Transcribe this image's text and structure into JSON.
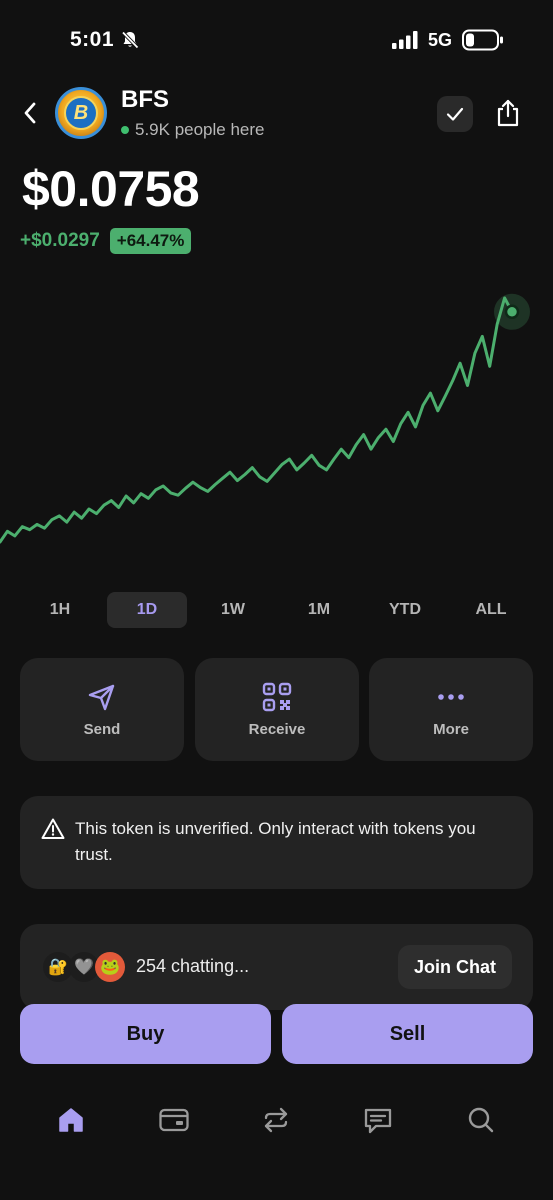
{
  "status_bar": {
    "time": "5:01",
    "network": "5G",
    "icons": [
      "bell-slash-icon",
      "signal-icon",
      "battery-icon"
    ]
  },
  "header": {
    "back_icon": "chevron-left-icon",
    "token_name": "BFS",
    "presence": "5.9K people here",
    "presence_color": "#3fbf6f",
    "avatar_letter": "B",
    "actions": [
      "check-icon",
      "share-icon"
    ]
  },
  "price": {
    "value": "$0.0758",
    "change_abs": "+$0.0297",
    "change_pct": "+64.47%",
    "positive_color": "#4caf6e"
  },
  "chart_data": {
    "type": "line",
    "series": [
      {
        "values": [
          0.0458,
          0.0472,
          0.0466,
          0.0478,
          0.0474,
          0.0481,
          0.0476,
          0.0487,
          0.0492,
          0.0484,
          0.0497,
          0.0489,
          0.0501,
          0.0495,
          0.0506,
          0.0512,
          0.0503,
          0.0518,
          0.0509,
          0.0521,
          0.0515,
          0.0526,
          0.0531,
          0.0522,
          0.0519,
          0.0528,
          0.0536,
          0.0529,
          0.0524,
          0.0533,
          0.0541,
          0.0549,
          0.0538,
          0.0546,
          0.0555,
          0.0543,
          0.0537,
          0.0548,
          0.0559,
          0.0566,
          0.0552,
          0.0561,
          0.0571,
          0.0558,
          0.0552,
          0.0566,
          0.0579,
          0.0568,
          0.0585,
          0.0598,
          0.0579,
          0.0594,
          0.0605,
          0.0589,
          0.0612,
          0.0627,
          0.0608,
          0.0636,
          0.0652,
          0.0629,
          0.0648,
          0.0668,
          0.0691,
          0.0662,
          0.0704,
          0.0726,
          0.0687,
          0.0742,
          0.0776,
          0.0758
        ],
        "color": "#4caf6e"
      }
    ],
    "xlabel": "",
    "ylabel": "",
    "grid": false,
    "current_point": 0.0758
  },
  "ranges": [
    "1H",
    "1D",
    "1W",
    "1M",
    "YTD",
    "ALL"
  ],
  "active_range": "1D",
  "active_range_color": "#a79af0",
  "actions": [
    {
      "label": "Send",
      "icon": "send-icon"
    },
    {
      "label": "Receive",
      "icon": "qr-code-icon"
    },
    {
      "label": "More",
      "icon": "more-dots-icon"
    }
  ],
  "accent_color": "#a99ef0",
  "warning": {
    "icon": "warning-triangle-icon",
    "text": "This token is unverified. Only interact with tokens you trust."
  },
  "chat": {
    "count_label": "254 chatting...",
    "join_label": "Join Chat",
    "avatars": [
      "🔐",
      "🩶",
      "🐸"
    ]
  },
  "trade": {
    "buy_label": "Buy",
    "sell_label": "Sell"
  },
  "nav": {
    "items": [
      "home-icon",
      "wallet-card-icon",
      "swap-icon",
      "chat-icon",
      "search-icon"
    ],
    "active": "home-icon"
  }
}
